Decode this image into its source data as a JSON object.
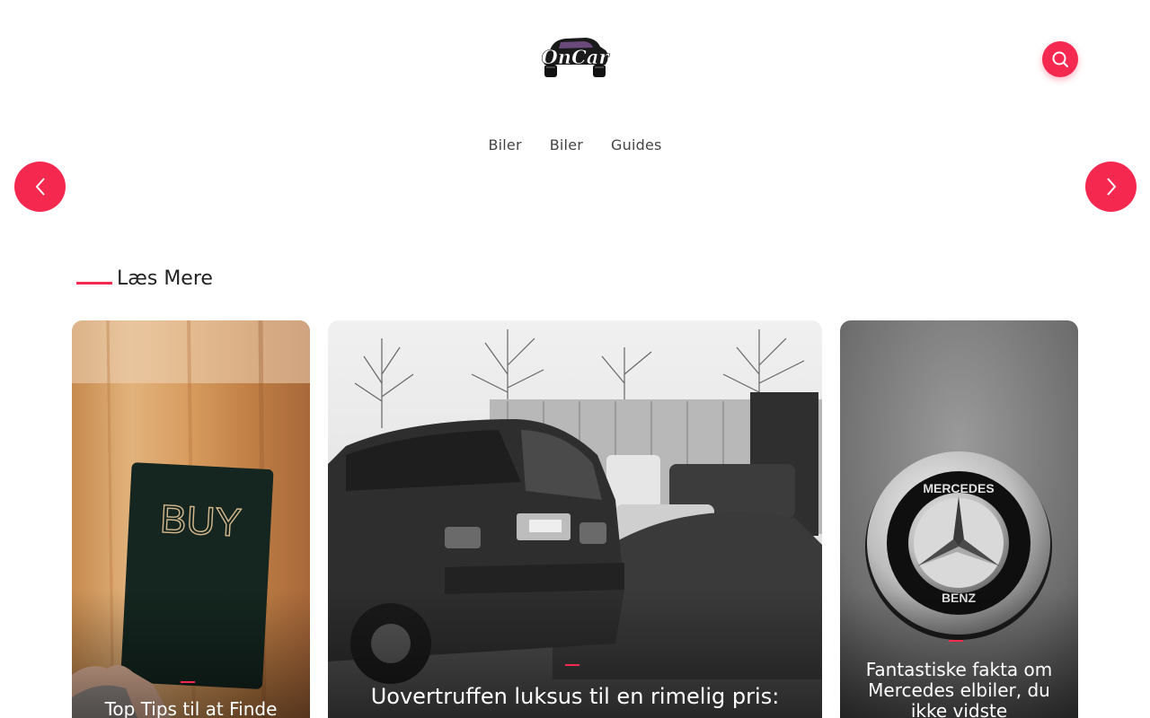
{
  "header": {
    "logo_text": "OnCar",
    "search_icon": "search-icon"
  },
  "nav": {
    "items": [
      {
        "label": "Biler"
      },
      {
        "label": "Biler"
      },
      {
        "label": "Guides"
      }
    ]
  },
  "carousel": {
    "prev_icon": "chevron-left-icon",
    "next_icon": "chevron-right-icon"
  },
  "section": {
    "title": "Læs Mere"
  },
  "cards": [
    {
      "title": "Top Tips til at Finde",
      "image": "buy-card-photo"
    },
    {
      "title": "Uovertruffen luksus til en rimelig pris:",
      "image": "suv-photo"
    },
    {
      "title": "Fantastiske fakta om Mercedes elbiler, du ikke vidste",
      "image": "mercedes-emblem-photo"
    }
  ],
  "colors": {
    "accent": "#f5284f",
    "text": "#222222",
    "nav_text": "#444444"
  }
}
